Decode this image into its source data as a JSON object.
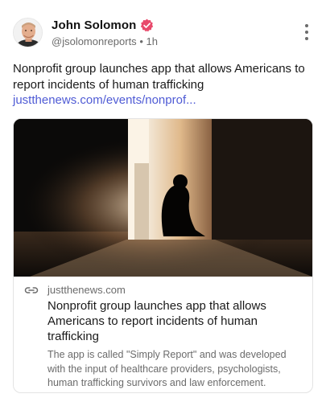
{
  "author": {
    "name": "John Solomon",
    "handle": "@jsolomonreports",
    "separator": "•",
    "time": "1h"
  },
  "post": {
    "text": "Nonprofit group launches app that allows Americans to report incidents of human trafficking",
    "link": "justthenews.com/events/nonprof..."
  },
  "card": {
    "domain": "justthenews.com",
    "title": "Nonprofit group launches app that allows Americans to report incidents of human trafficking",
    "description": "The app is called \"Simply Report\" and was developed with the input of healthcare providers, psychologists, human trafficking survivors and law enforcement."
  },
  "icons": {
    "verified": "verified-badge-icon",
    "menu": "more-vertical-icon",
    "link": "link-icon"
  },
  "colors": {
    "link": "#4f5bd5",
    "verified": "#e8496b",
    "muted": "#6b6b6b"
  }
}
